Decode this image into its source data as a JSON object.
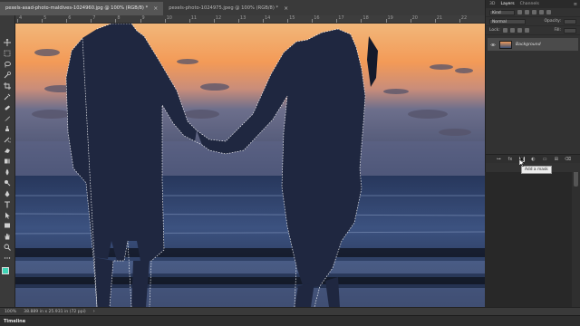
{
  "document_tabs": [
    {
      "label": "pexels-asad-photo-maldives-1024960.jpg @ 100% (RGB/8) *",
      "active": true
    },
    {
      "label": "pexels-photo-1024975.jpeg @ 100% (RGB/8) *",
      "active": false
    }
  ],
  "ruler": {
    "ticks": [
      "4",
      "5",
      "6",
      "7",
      "8",
      "9",
      "10",
      "11",
      "12",
      "13",
      "14",
      "15",
      "16",
      "17",
      "18",
      "19",
      "20",
      "21",
      "22"
    ]
  },
  "toolbar": {
    "tools": [
      "move-icon",
      "marquee-icon",
      "lasso-icon",
      "quick-select-icon",
      "crop-icon",
      "eyedropper-icon",
      "healing-icon",
      "brush-icon",
      "clone-stamp-icon",
      "history-brush-icon",
      "eraser-icon",
      "gradient-icon",
      "blur-icon",
      "dodge-icon",
      "pen-icon",
      "type-icon",
      "path-select-icon",
      "shape-icon",
      "hand-icon",
      "zoom-icon",
      "more-tools-icon"
    ],
    "foreground_color": "#3fd4b6",
    "background_color": "#1a1a1a"
  },
  "layers_panel": {
    "tabs": [
      {
        "label": "3D",
        "active": false
      },
      {
        "label": "Layers",
        "active": true
      },
      {
        "label": "Channels",
        "active": false
      }
    ],
    "filter": {
      "value": "Kind"
    },
    "blend_mode": {
      "value": "Normal",
      "opacity_label": "Opacity:"
    },
    "lock": {
      "label": "Lock:",
      "fill_label": "Fill:"
    },
    "layer": {
      "name": "Background",
      "visible": true
    },
    "footer_buttons": [
      "link-icon",
      "fx-icon",
      "add-mask-icon",
      "adjustment-icon",
      "group-icon",
      "new-layer-icon",
      "trash-icon"
    ],
    "tooltip": "Add a mask"
  },
  "status_bar": {
    "zoom": "100%",
    "doc_info": "38.889 in x 25.931 in (72 ppi)"
  },
  "timeline": {
    "label": "Timeline"
  }
}
